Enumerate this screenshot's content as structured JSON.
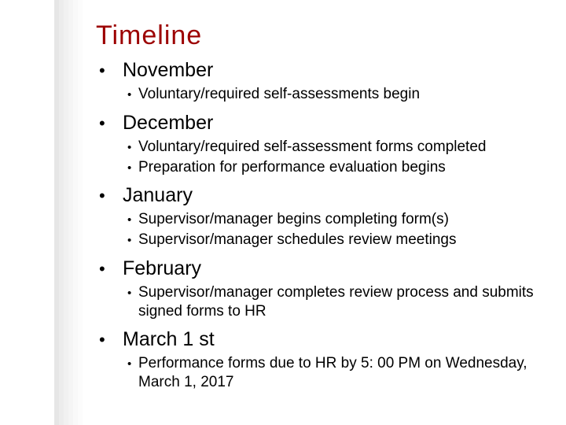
{
  "title": "Timeline",
  "sections": [
    {
      "month": "November",
      "items": [
        "Voluntary/required self-assessments begin"
      ]
    },
    {
      "month": "December",
      "items": [
        "Voluntary/required self-assessment forms completed",
        "Preparation for performance evaluation begins"
      ]
    },
    {
      "month": "January",
      "items": [
        "Supervisor/manager begins completing form(s)",
        "Supervisor/manager schedules review meetings"
      ]
    },
    {
      "month": "February",
      "items": [
        "Supervisor/manager completes review process and submits signed forms to HR"
      ]
    },
    {
      "month": "March 1 st",
      "items": [
        "Performance forms due to HR by 5: 00 PM on Wednesday, March 1, 2017"
      ]
    }
  ]
}
